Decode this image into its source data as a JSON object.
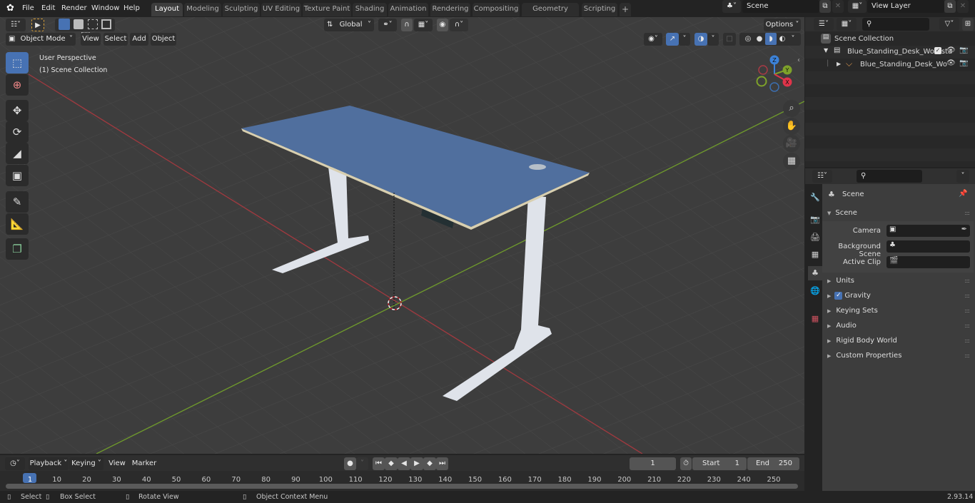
{
  "menu": {
    "items": [
      "File",
      "Edit",
      "Render",
      "Window",
      "Help"
    ]
  },
  "workspaces": [
    {
      "label": "Layout",
      "active": true
    },
    {
      "label": "Modeling"
    },
    {
      "label": "Sculpting"
    },
    {
      "label": "UV Editing"
    },
    {
      "label": "Texture Paint"
    },
    {
      "label": "Shading"
    },
    {
      "label": "Animation"
    },
    {
      "label": "Rendering"
    },
    {
      "label": "Compositing"
    },
    {
      "label": "Geometry Nodes"
    },
    {
      "label": "Scripting"
    }
  ],
  "add_workspace": "+",
  "scene_selector": {
    "value": "Scene"
  },
  "view_layer_selector": {
    "value": "View Layer"
  },
  "viewport_header": {
    "mode": "Object Mode",
    "menus": [
      "View",
      "Select",
      "Add",
      "Object"
    ],
    "transform_orientation": "Global",
    "options": "Options"
  },
  "viewport_overlay": {
    "line1": "User Perspective",
    "line2": "(1) Scene Collection"
  },
  "gizmo": {
    "x": "X",
    "y": "Y",
    "z": "Z"
  },
  "outliner": {
    "search_placeholder": "",
    "items": [
      {
        "label": "Scene Collection",
        "type": "scene-collection"
      },
      {
        "label": "Blue_Standing_Desk_Worksta",
        "type": "collection",
        "checked": true
      },
      {
        "label": "Blue_Standing_Desk_Wo",
        "type": "empty"
      }
    ]
  },
  "properties": {
    "breadcrumb": "Scene",
    "panel_title": "Scene",
    "fields": [
      {
        "label": "Camera",
        "value": ""
      },
      {
        "label": "Background Scene",
        "value": ""
      },
      {
        "label": "Active Clip",
        "value": ""
      }
    ],
    "sections": [
      {
        "label": "Units"
      },
      {
        "label": "Gravity",
        "checked": true
      },
      {
        "label": "Keying Sets"
      },
      {
        "label": "Audio"
      },
      {
        "label": "Rigid Body World"
      },
      {
        "label": "Custom Properties"
      }
    ]
  },
  "timeline": {
    "menus": [
      "Playback",
      "Keying",
      "View",
      "Marker"
    ],
    "current_frame": "1",
    "start_label": "Start",
    "start": "1",
    "end_label": "End",
    "end": "250",
    "ticks": [
      "1",
      "10",
      "20",
      "30",
      "40",
      "50",
      "60",
      "70",
      "80",
      "90",
      "100",
      "110",
      "120",
      "130",
      "140",
      "150",
      "160",
      "170",
      "180",
      "190",
      "200",
      "210",
      "220",
      "230",
      "240",
      "250"
    ]
  },
  "statusbar": {
    "select": "Select",
    "box_select": "Box Select",
    "rotate_view": "Rotate View",
    "context_menu": "Object Context Menu",
    "version": "2.93.14"
  }
}
